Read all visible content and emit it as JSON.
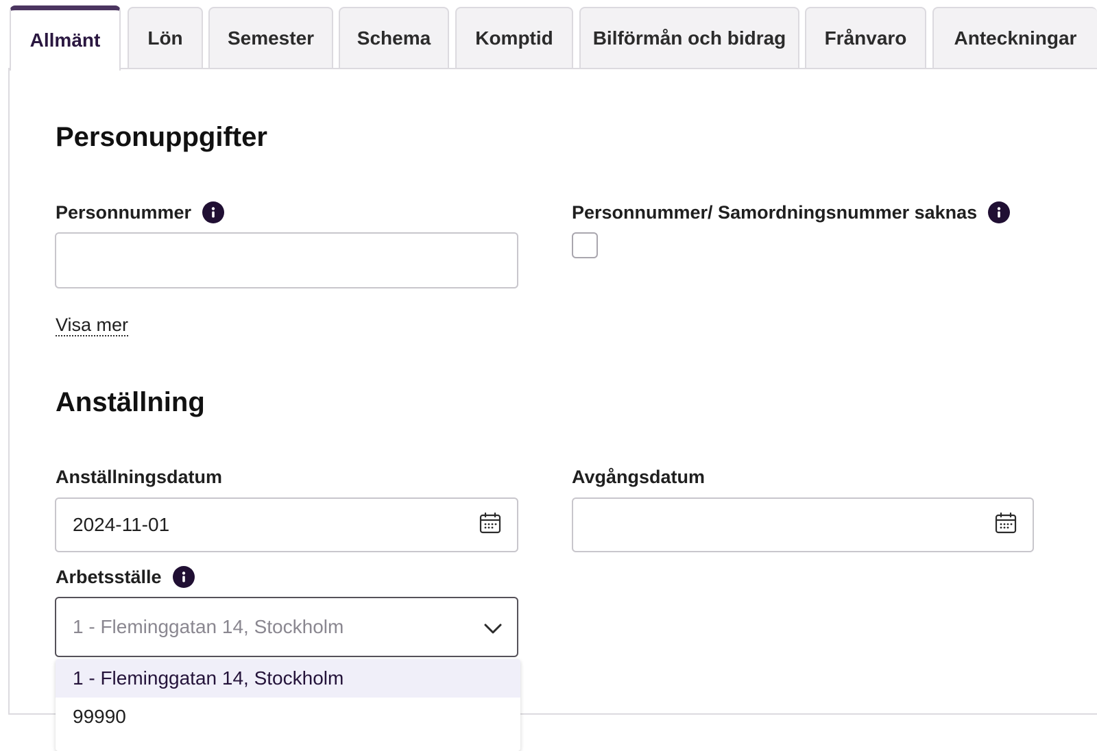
{
  "tabs": [
    {
      "label": "Allmänt",
      "active": true
    },
    {
      "label": "Lön"
    },
    {
      "label": "Semester"
    },
    {
      "label": "Schema"
    },
    {
      "label": "Komptid"
    },
    {
      "label": "Bilförmån och bidrag"
    },
    {
      "label": "Frånvaro"
    },
    {
      "label": "Anteckningar"
    }
  ],
  "personuppgifter": {
    "title": "Personuppgifter",
    "personnummer_label": "Personnummer",
    "personnummer_value": "",
    "saknas_label": "Personnummer/ Samordningsnummer saknas",
    "saknas_checked": false,
    "visa_mer": "Visa mer"
  },
  "anstallning": {
    "title": "Anställning",
    "anstallningsdatum_label": "Anställningsdatum",
    "anstallningsdatum_value": "2024-11-01",
    "avgangsdatum_label": "Avgångsdatum",
    "avgangsdatum_value": "",
    "arbetsstalle_label": "Arbetsställe",
    "arbetsstalle_selected": "1 - Fleminggatan 14, Stockholm",
    "arbetsstalle_options": [
      "1 - Fleminggatan 14, Stockholm",
      "99990"
    ]
  },
  "icons": {
    "info": "info-icon",
    "calendar": "calendar-icon",
    "chevron": "chevron-down-icon"
  },
  "colors": {
    "accent": "#4b3560",
    "info_icon": "#200f33",
    "option_highlight": "#f0eff9"
  }
}
